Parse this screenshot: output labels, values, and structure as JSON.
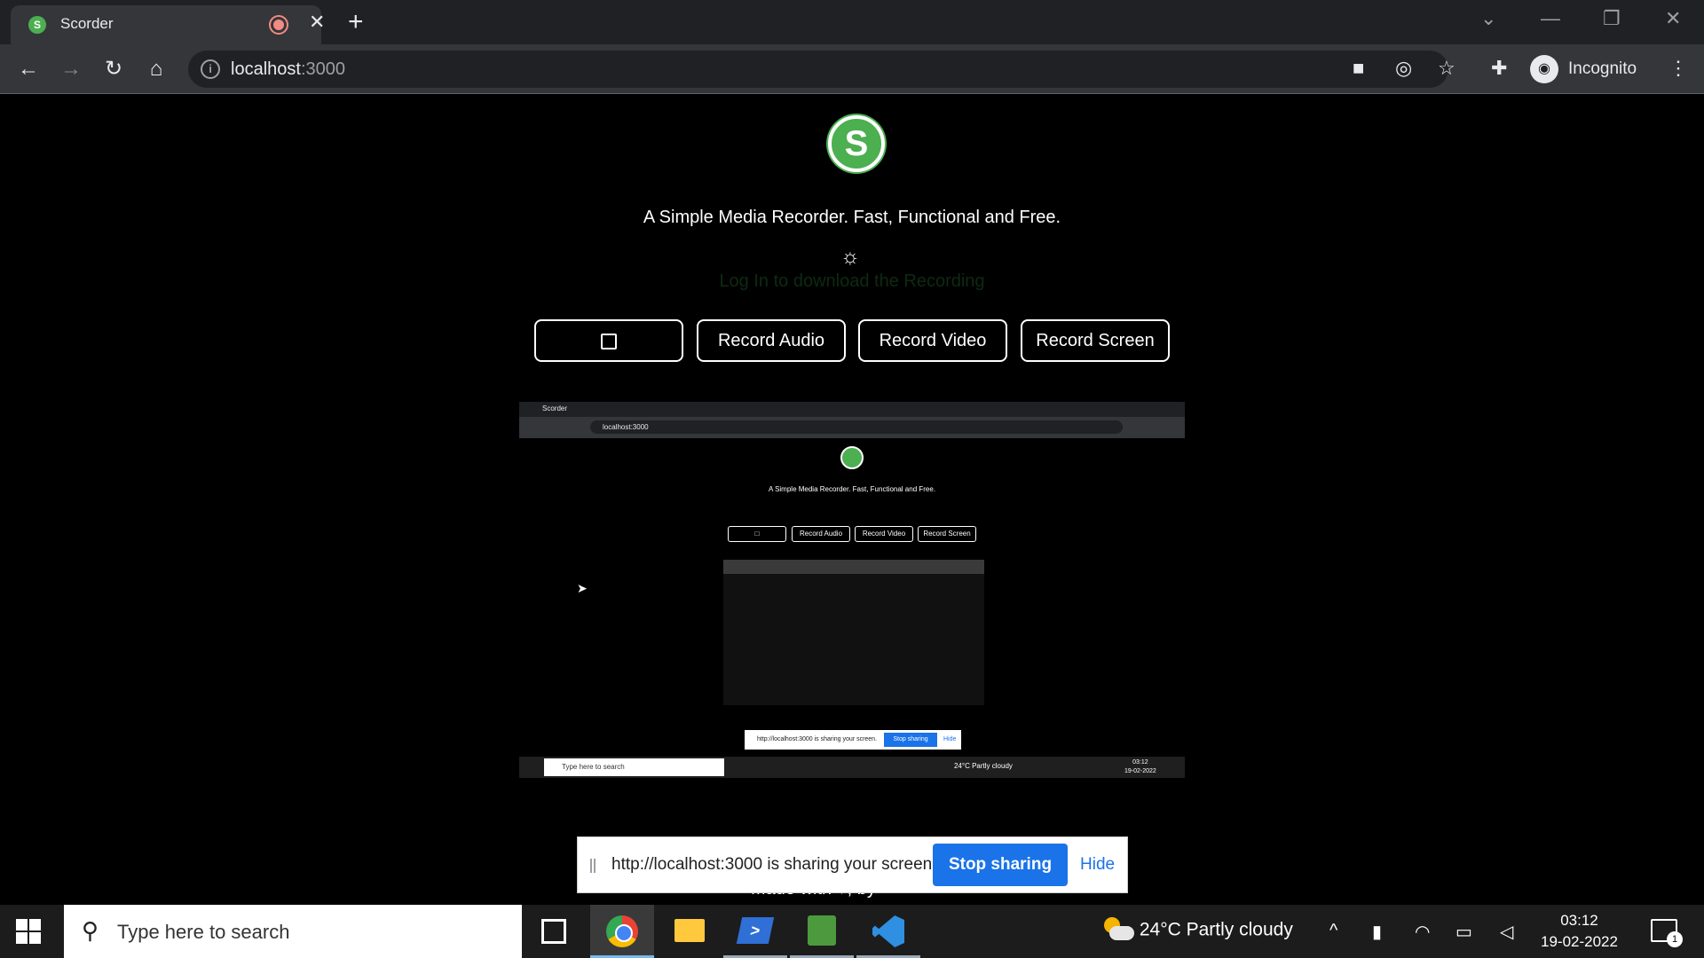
{
  "browser": {
    "tab": {
      "title": "Scorder",
      "favicon_letter": "S",
      "recording_icon": "record-dot-icon",
      "close_glyph": "✕"
    },
    "new_tab_glyph": "+",
    "url": {
      "host": "localhost",
      "port": ":3000"
    },
    "profile_label": "Incognito"
  },
  "app": {
    "logo_letter": "S",
    "tagline": "A Simple Media Recorder. Fast, Functional and Free.",
    "theme_icon": "☼",
    "login_hint": "Log In to download the Recording",
    "buttons": {
      "record_audio": "Record Audio",
      "record_video": "Record Video",
      "record_screen": "Record Screen"
    },
    "footer": "Made with ♥, by"
  },
  "preview": {
    "tab_title": "Scorder",
    "url": "localhost:3000",
    "tagline": "A Simple Media Recorder. Fast, Functional and Free.",
    "buttons": [
      "Record Audio",
      "Record Video",
      "Record Screen"
    ],
    "share_msg": "http://localhost:3000 is sharing your screen.",
    "share_stop": "Stop sharing",
    "share_hide": "Hide",
    "search_placeholder": "Type here to search",
    "weather": "24°C Partly cloudy",
    "time": "03:12",
    "date": "19-02-2022"
  },
  "share_bar": {
    "message": "http://localhost:3000 is sharing your screen.",
    "stop_label": "Stop sharing",
    "hide_label": "Hide"
  },
  "taskbar": {
    "search_placeholder": "Type here to search",
    "weather_temp": "24°C",
    "weather_desc": "Partly cloudy",
    "time": "03:12",
    "date": "19-02-2022",
    "notification_count": "1"
  },
  "colors": {
    "accent": "#4caf50",
    "chrome_dark": "#202124",
    "chrome_toolbar": "#35363a",
    "share_blue": "#1a73e8"
  }
}
